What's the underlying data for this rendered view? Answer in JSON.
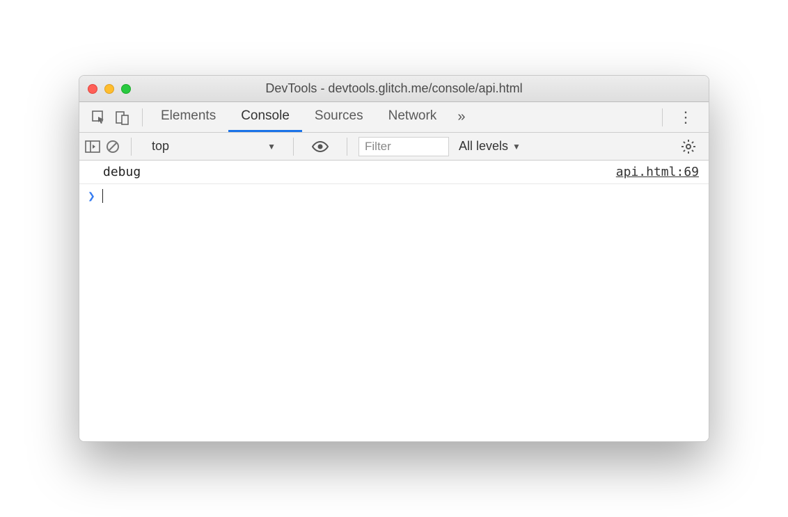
{
  "window": {
    "title": "DevTools - devtools.glitch.me/console/api.html"
  },
  "tabs": {
    "items": [
      "Elements",
      "Console",
      "Sources",
      "Network"
    ],
    "active_index": 1,
    "overflow_glyph": "»"
  },
  "subbar": {
    "context": "top",
    "filter_placeholder": "Filter",
    "levels_label": "All levels"
  },
  "console": {
    "messages": [
      {
        "text": "debug",
        "source": "api.html:69"
      }
    ],
    "prompt_glyph": "❯"
  }
}
